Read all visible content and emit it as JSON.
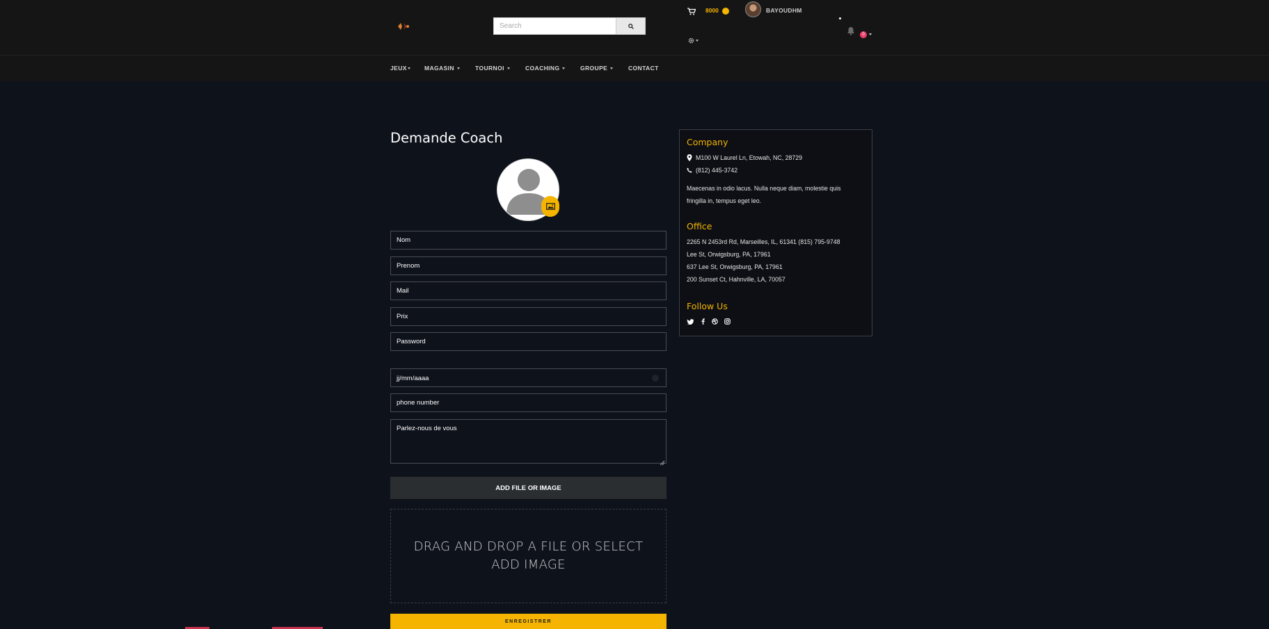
{
  "header": {
    "search_placeholder": "Search",
    "coins": "8000",
    "username": "BAYOUDHM",
    "notification_count": "0"
  },
  "nav": {
    "items": [
      {
        "label": "JEUX"
      },
      {
        "label": "MAGASIN"
      },
      {
        "label": "TOURNOI"
      },
      {
        "label": "COACHING"
      },
      {
        "label": "GROUPE"
      },
      {
        "label": "CONTACT"
      }
    ]
  },
  "form": {
    "title": "Demande Coach",
    "fields": {
      "nom": "Nom",
      "prenom": "Prenom",
      "mail": "Mail",
      "prix": "Prix",
      "password": "Password",
      "date": "jj/mm/aaaa",
      "phone": "phone number",
      "about": "Parlez-nous de vous"
    },
    "add_file_label": "ADD FILE OR IMAGE",
    "dropzone_text": "DRAG AND DROP A FILE OR SELECT ADD IMAGE",
    "submit_label": "ENREGISTRER"
  },
  "sidebar": {
    "company_heading": "Company",
    "company_address": "M100 W Laurel Ln, Etowah, NC, 28729",
    "company_phone": "(812) 445-3742",
    "company_desc": "Maecenas in odio lacus. Nulla neque diam, molestie quis fringilla in, tempus eget leo.",
    "office_heading": "Office",
    "office_lines": [
      "2265 N 2453rd Rd, Marseilles, IL, 61341 (815) 795-9748",
      "Lee St, Orwigsburg, PA, 17961",
      "637 Lee St, Orwigsburg, PA, 17961",
      "200 Sunset Ct, Hahnville, LA, 70057"
    ],
    "follow_heading": "Follow Us"
  },
  "colors": {
    "accent": "#f5b400",
    "background": "#0e121b",
    "header": "#151515",
    "badge": "#e83e6a"
  }
}
